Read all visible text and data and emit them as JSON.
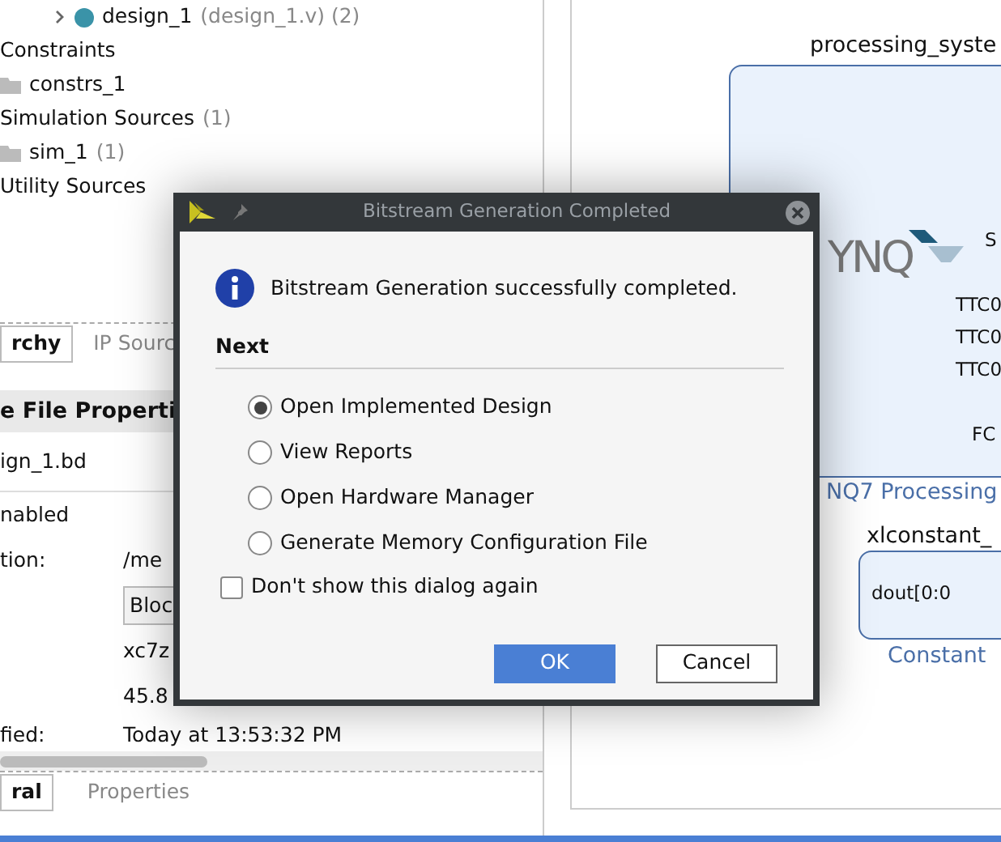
{
  "tree": [
    {
      "kind": "design",
      "label": "design_1",
      "detail": "(design_1.v) (2)",
      "expanded": false
    },
    {
      "kind": "group",
      "label": "Constraints",
      "children": [
        {
          "kind": "folder",
          "label": "constrs_1"
        }
      ]
    },
    {
      "kind": "group",
      "label": "Simulation Sources",
      "count": "(1)",
      "children": [
        {
          "kind": "folder",
          "label": "sim_1",
          "count": "(1)"
        }
      ]
    },
    {
      "kind": "group",
      "label": "Utility Sources"
    }
  ],
  "source_tabs": [
    {
      "label": "rchy",
      "selected": true
    },
    {
      "label": "IP Sourc",
      "selected": false
    }
  ],
  "properties": {
    "title": "e File Properti",
    "file_name": "ign_1.bd",
    "status": "nabled",
    "rows": [
      {
        "kind": "text",
        "label": "tion:",
        "value": "/me"
      },
      {
        "kind": "select",
        "value": "Bloc"
      },
      {
        "kind": "text",
        "value": "xc7z"
      },
      {
        "kind": "text",
        "value": "45.8"
      },
      {
        "kind": "text",
        "label": "fied:",
        "value": "Today at 13:53:32 PM"
      }
    ]
  },
  "bottom_tabs": [
    {
      "label": "ral",
      "selected": true
    },
    {
      "label": "Properties",
      "selected": false
    }
  ],
  "diagram": {
    "blocks": [
      {
        "kind": "ps",
        "name": "processing_syste",
        "logo_text": "YNQ",
        "ports": [
          "S",
          "TTC0",
          "TTC0",
          "TTC0",
          "FC"
        ],
        "caption": "NQ7 Processing"
      },
      {
        "kind": "const",
        "name": "xlconstant_",
        "ports": [
          "dout[0:0"
        ],
        "caption": "Constant"
      }
    ]
  },
  "dialog": {
    "title": "Bitstream Generation Completed",
    "message": "Bitstream Generation successfully completed.",
    "section": "Next",
    "options": [
      {
        "label": "Open Implemented Design",
        "selected": true
      },
      {
        "label": "View Reports",
        "selected": false
      },
      {
        "label": "Open Hardware Manager",
        "selected": false
      },
      {
        "label": "Generate Memory Configuration File",
        "selected": false
      }
    ],
    "dont_show": {
      "label": "Don't show this dialog again",
      "checked": false
    },
    "buttons": [
      {
        "kind": "primary",
        "label": "OK"
      },
      {
        "kind": "secondary",
        "label": "Cancel"
      }
    ]
  }
}
